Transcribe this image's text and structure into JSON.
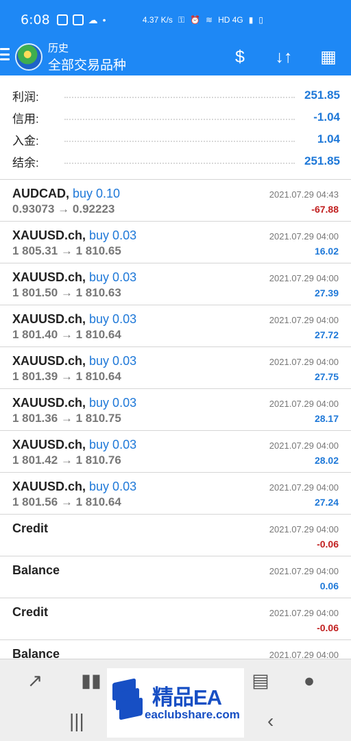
{
  "status_bar": {
    "time": "6:08",
    "speed": "4.37\nK/s",
    "network": "HD 4G",
    "battery_icon": "battery-icon"
  },
  "header": {
    "subtitle": "历史",
    "title": "全部交易品种",
    "actions": [
      "currency-exchange-icon",
      "sort-icon",
      "calendar-icon"
    ]
  },
  "summary": [
    {
      "label": "利润:",
      "value": "251.85"
    },
    {
      "label": "信用:",
      "value": "-1.04"
    },
    {
      "label": "入金:",
      "value": "1.04"
    },
    {
      "label": "结余:",
      "value": "251.85"
    }
  ],
  "trades": [
    {
      "symbol": "AUDCAD,",
      "side": "buy 0.10",
      "price": "0.93073 → 0.92223",
      "time": "2021.07.29 04:43",
      "profit": "-67.88",
      "sign": "negative"
    },
    {
      "symbol": "XAUUSD.ch,",
      "side": "buy 0.03",
      "price": "1 805.31 → 1 810.65",
      "time": "2021.07.29 04:00",
      "profit": "16.02",
      "sign": "positive"
    },
    {
      "symbol": "XAUUSD.ch,",
      "side": "buy 0.03",
      "price": "1 801.50 → 1 810.63",
      "time": "2021.07.29 04:00",
      "profit": "27.39",
      "sign": "positive"
    },
    {
      "symbol": "XAUUSD.ch,",
      "side": "buy 0.03",
      "price": "1 801.40 → 1 810.64",
      "time": "2021.07.29 04:00",
      "profit": "27.72",
      "sign": "positive"
    },
    {
      "symbol": "XAUUSD.ch,",
      "side": "buy 0.03",
      "price": "1 801.39 → 1 810.64",
      "time": "2021.07.29 04:00",
      "profit": "27.75",
      "sign": "positive"
    },
    {
      "symbol": "XAUUSD.ch,",
      "side": "buy 0.03",
      "price": "1 801.36 → 1 810.75",
      "time": "2021.07.29 04:00",
      "profit": "28.17",
      "sign": "positive"
    },
    {
      "symbol": "XAUUSD.ch,",
      "side": "buy 0.03",
      "price": "1 801.42 → 1 810.76",
      "time": "2021.07.29 04:00",
      "profit": "28.02",
      "sign": "positive"
    },
    {
      "symbol": "XAUUSD.ch,",
      "side": "buy 0.03",
      "price": "1 801.56 → 1 810.64",
      "time": "2021.07.29 04:00",
      "profit": "27.24",
      "sign": "positive"
    },
    {
      "symbol": "Credit",
      "side": "",
      "price": "",
      "time": "2021.07.29 04:00",
      "profit": "-0.06",
      "sign": "negative"
    },
    {
      "symbol": "Balance",
      "side": "",
      "price": "",
      "time": "2021.07.29 04:00",
      "profit": "0.06",
      "sign": "positive"
    },
    {
      "symbol": "Credit",
      "side": "",
      "price": "",
      "time": "2021.07.29 04:00",
      "profit": "-0.06",
      "sign": "negative"
    },
    {
      "symbol": "Balance",
      "side": "",
      "price": "",
      "time": "2021.07.29 04:00",
      "profit": "",
      "sign": "positive"
    }
  ],
  "bottom_nav": [
    "trend-icon",
    "candlestick-icon",
    "news-icon",
    "chat-icon"
  ],
  "system_nav": [
    "recent-apps-icon",
    "home-icon",
    "back-icon"
  ],
  "watermark": {
    "main": "精品EA",
    "domain": "eaclubshare.com"
  }
}
